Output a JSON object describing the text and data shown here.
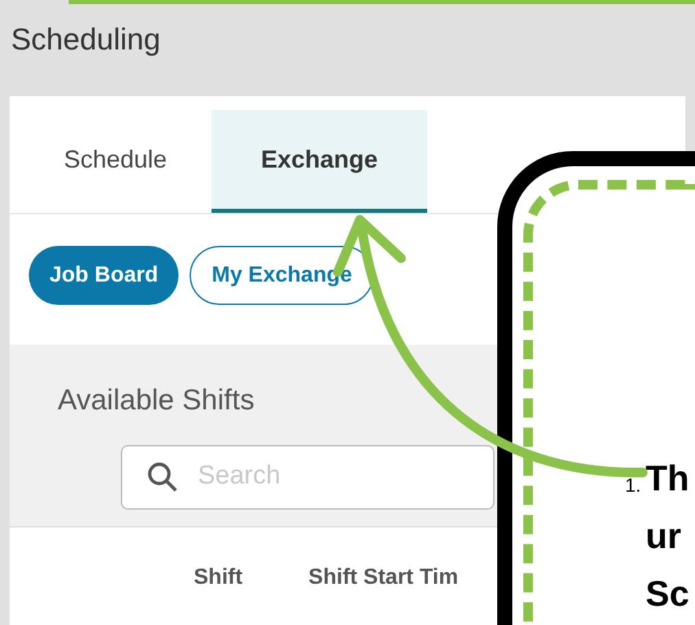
{
  "page_title": "Scheduling",
  "tabs": [
    {
      "label": "Schedule",
      "selected": false
    },
    {
      "label": "Exchange",
      "selected": true
    }
  ],
  "view_toggle": [
    {
      "label": "Job Board",
      "selected": true
    },
    {
      "label": "My Exchange",
      "selected": false
    }
  ],
  "section_title": "Available Shifts",
  "search": {
    "placeholder": "Search"
  },
  "table": {
    "columns": [
      "Shift",
      "Shift Start Tim"
    ]
  },
  "callout": {
    "marker": "1.",
    "lines": [
      "Th",
      "ur",
      "Sc"
    ]
  }
}
